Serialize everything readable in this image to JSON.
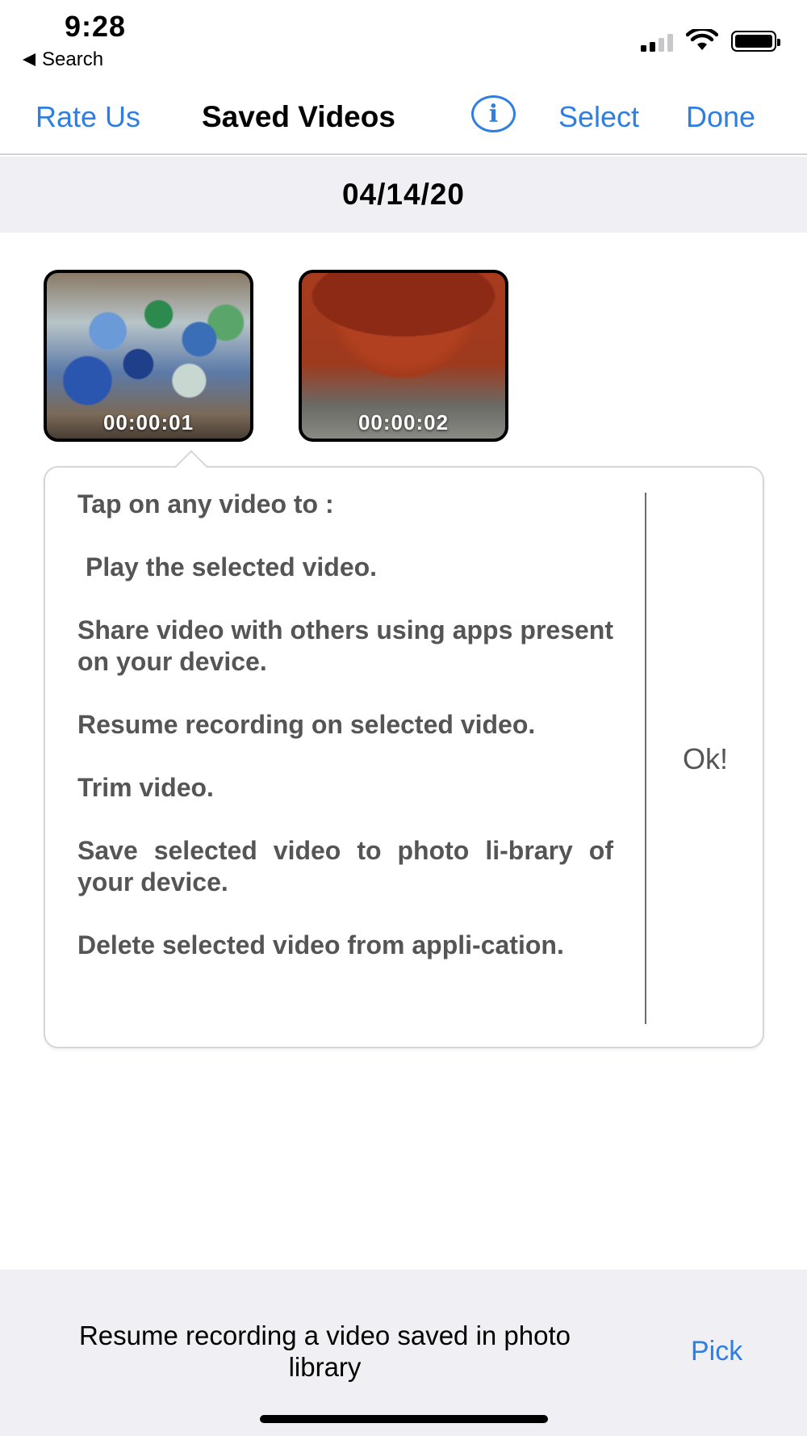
{
  "status_bar": {
    "time": "9:28",
    "back_label": "Search"
  },
  "nav": {
    "rate_us": "Rate Us",
    "title": "Saved Videos",
    "info_icon": "i",
    "select": "Select",
    "done": "Done"
  },
  "section": {
    "date": "04/14/20"
  },
  "videos": [
    {
      "duration": "00:00:01"
    },
    {
      "duration": "00:00:02"
    }
  ],
  "popover": {
    "lines": [
      "Tap on any video to :",
      "Play the selected video.",
      "Share video with others using apps present on your device.",
      "Resume recording on selected video.",
      "Trim video.",
      "Save selected video to photo li-brary of your device.",
      "Delete selected video from appli-cation."
    ],
    "ok_label": "Ok!"
  },
  "bottom_bar": {
    "text": "Resume recording a video saved in photo library",
    "pick_label": "Pick"
  },
  "colors": {
    "accent": "#2e7fe0",
    "section_bg": "#efeff4",
    "popover_text": "#555555"
  }
}
